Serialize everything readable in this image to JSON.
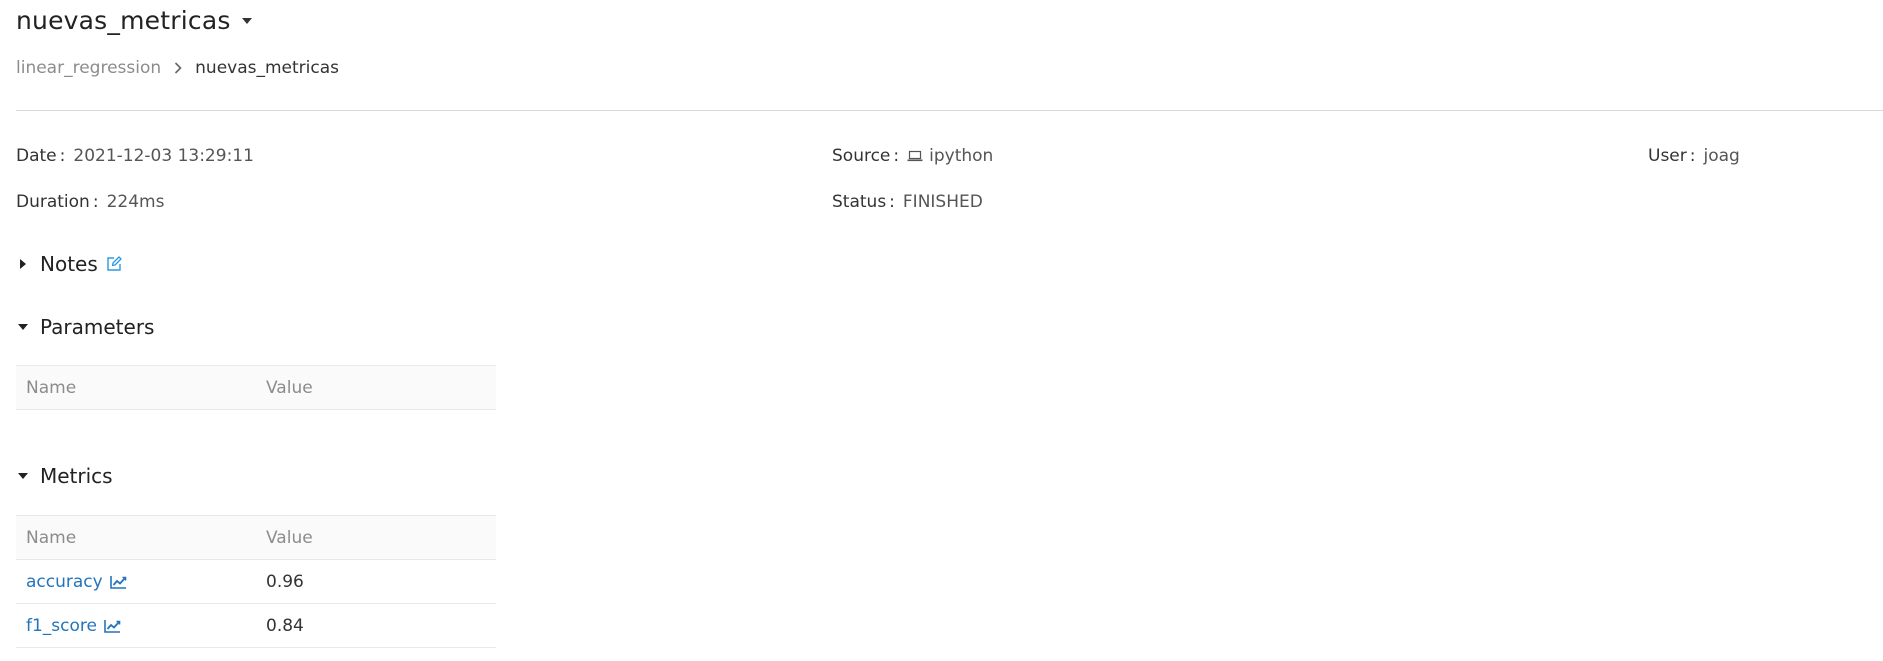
{
  "header": {
    "title": "nuevas_metricas",
    "breadcrumb": {
      "experiment": "linear_regression",
      "run": "nuevas_metricas"
    }
  },
  "meta": {
    "date": {
      "label": "Date",
      "value": "2021-12-03 13:29:11"
    },
    "source": {
      "label": "Source",
      "value": "ipython",
      "icon": "laptop-icon"
    },
    "user": {
      "label": "User",
      "value": "joag"
    },
    "duration": {
      "label": "Duration",
      "value": "224ms"
    },
    "status": {
      "label": "Status",
      "value": "FINISHED"
    }
  },
  "sections": {
    "notes": {
      "title": "Notes",
      "expanded": false
    },
    "parameters": {
      "title": "Parameters",
      "expanded": true,
      "columns": [
        "Name",
        "Value"
      ],
      "rows": []
    },
    "metrics": {
      "title": "Metrics",
      "expanded": true,
      "columns": [
        "Name",
        "Value"
      ],
      "rows": [
        {
          "name": "accuracy",
          "value": "0.96"
        },
        {
          "name": "f1_score",
          "value": "0.84"
        }
      ]
    }
  },
  "colors": {
    "link": "#2374bb",
    "muted": "#8c8c8c",
    "edit_icon": "#2a9be0"
  }
}
